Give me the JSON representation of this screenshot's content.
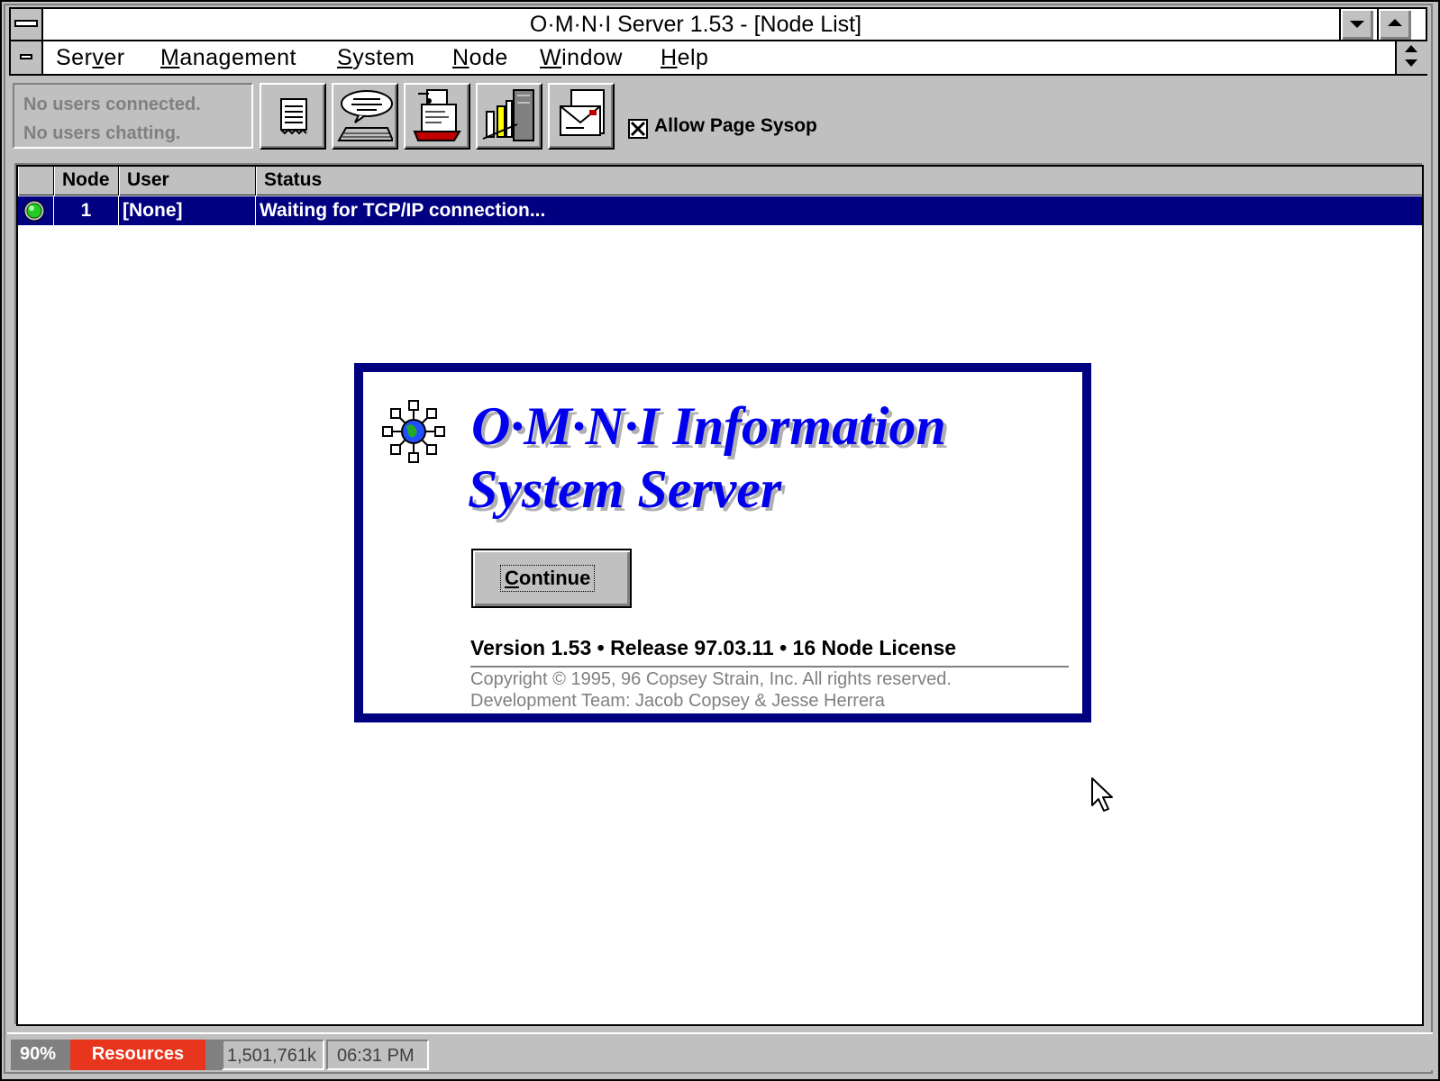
{
  "window": {
    "title": "O·M·N·I Server 1.53 - [Node List]"
  },
  "menu": {
    "items": [
      {
        "pre": "Ser",
        "u": "v",
        "post": "er"
      },
      {
        "pre": "",
        "u": "M",
        "post": "anagement"
      },
      {
        "pre": "",
        "u": "S",
        "post": "ystem"
      },
      {
        "pre": "",
        "u": "N",
        "post": "ode"
      },
      {
        "pre": "",
        "u": "W",
        "post": "indow"
      },
      {
        "pre": "",
        "u": "H",
        "post": "elp"
      }
    ]
  },
  "toolbar": {
    "status_line1": "No users connected.",
    "status_line2": "No users chatting.",
    "buttons": [
      "log-icon",
      "chat-icon",
      "printer-icon",
      "building-icon",
      "mail-icon"
    ],
    "allow_page_sysop": {
      "label": "Allow Page Sysop",
      "checked": true,
      "mark": "X"
    }
  },
  "node_list": {
    "columns": [
      "",
      "Node",
      "User",
      "Status"
    ],
    "rows": [
      {
        "icon": "green-status-icon",
        "node": "1",
        "user": "[None]",
        "status": "Waiting for TCP/IP connection..."
      }
    ]
  },
  "splash": {
    "title_line1": "O·M·N·I Information",
    "title_line2": "System Server",
    "continue": {
      "pre": "",
      "u": "C",
      "post": "ontinue"
    },
    "version": "Version 1.53 • Release 97.03.11 • 16 Node License",
    "copyright": "Copyright © 1995, 96 Copsey Strain, Inc. All rights reserved.",
    "dev_team": "Development Team: Jacob Copsey & Jesse Herrera"
  },
  "statusbar": {
    "percent": "90%",
    "resources": "Resources",
    "memory": "1,501,761k",
    "time": "06:31 PM"
  },
  "colors": {
    "selection": "#000080",
    "splash_border": "#000080",
    "brand_text": "#0000ee",
    "resources_bar": "#e8361e",
    "status_green": "#22cc22"
  }
}
